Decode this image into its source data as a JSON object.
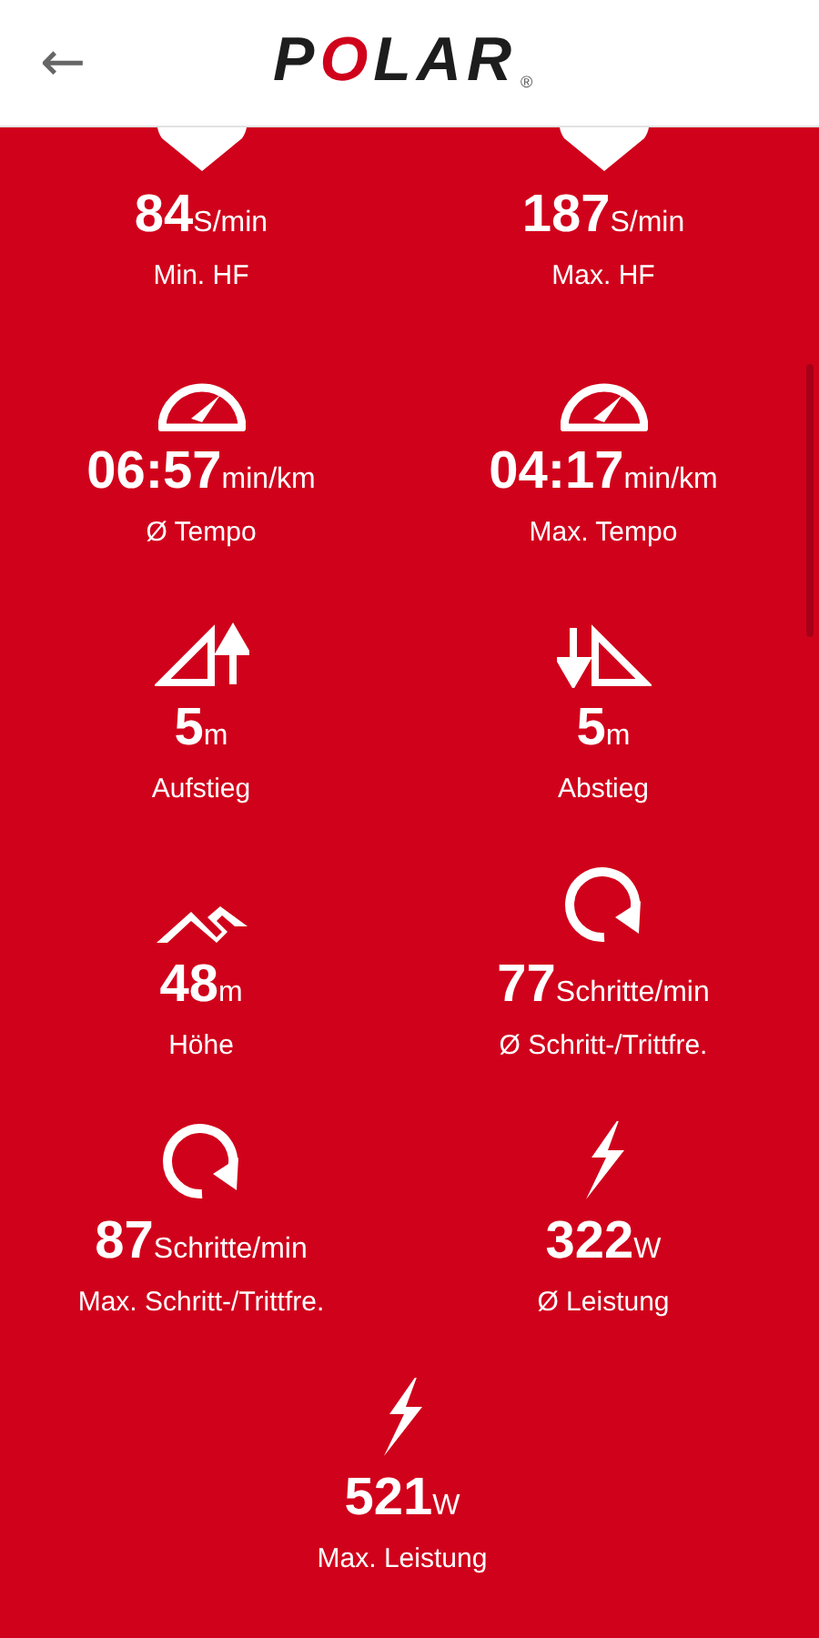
{
  "header": {
    "back": "←",
    "logo": "POLAR",
    "trademark": "®"
  },
  "stats": [
    {
      "kind": "heart",
      "value": "84",
      "unit": "S/min",
      "label": "Min. HF"
    },
    {
      "kind": "heart",
      "value": "187",
      "unit": "S/min",
      "label": "Max. HF"
    },
    {
      "kind": "gauge",
      "value": "06:57",
      "unit": "min/km",
      "label": "Ø Tempo"
    },
    {
      "kind": "gauge",
      "value": "04:17",
      "unit": "min/km",
      "label": "Max. Tempo"
    },
    {
      "kind": "ascent",
      "value": "5",
      "unit": "m",
      "label": "Aufstieg"
    },
    {
      "kind": "descent",
      "value": "5",
      "unit": "m",
      "label": "Abstieg"
    },
    {
      "kind": "mountain",
      "value": "48",
      "unit": "m",
      "label": "Höhe"
    },
    {
      "kind": "cycle",
      "value": "77",
      "unit": "Schritte/min",
      "label": "Ø Schritt-/Trittfre."
    },
    {
      "kind": "cycle",
      "value": "87",
      "unit": "Schritte/min",
      "label": "Max. Schritt-/Trittfre."
    },
    {
      "kind": "bolt",
      "value": "322",
      "unit": "W",
      "label": "Ø Leistung"
    },
    {
      "kind": "bolt",
      "value": "521",
      "unit": "W",
      "label": "Max. Leistung"
    }
  ]
}
